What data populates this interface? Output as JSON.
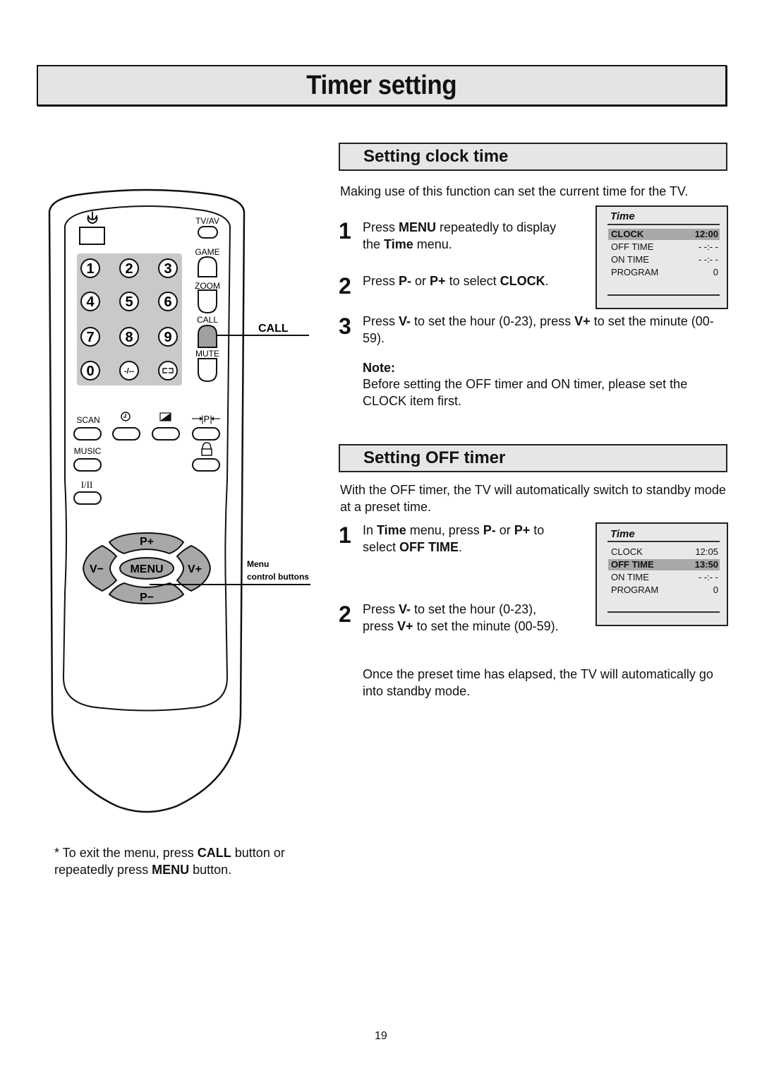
{
  "page": {
    "title": "Timer setting",
    "page_number": "19"
  },
  "remote": {
    "labels": {
      "tvav": "TV/AV",
      "game": "GAME",
      "zoom": "ZOOM",
      "call": "CALL",
      "mute": "MUTE",
      "scan": "SCAN",
      "music": "MUSIC",
      "dual": "I/II"
    },
    "digits": [
      "1",
      "2",
      "3",
      "4",
      "5",
      "6",
      "7",
      "8",
      "9",
      "0",
      "-/--"
    ],
    "nav": {
      "p_plus": "P+",
      "p_minus": "P−",
      "v_minus": "V−",
      "v_plus": "V+",
      "menu": "MENU"
    },
    "icons": [
      "power-icon",
      "clock-icon",
      "picture-mode-icon",
      "program-swap-icon",
      "lock-icon",
      "swap-icon"
    ],
    "callouts": {
      "call": "CALL",
      "menu_line1": "Menu",
      "menu_line2": "control buttons"
    },
    "colors": {
      "panel": "#c9c9c9",
      "highlight": "#a0a0a0"
    }
  },
  "footnote": {
    "prefix": "* To exit the menu, press ",
    "bold1": "CALL",
    "mid": " button or repeatedly press ",
    "bold2": "MENU",
    "suffix": " button."
  },
  "clock_section": {
    "title": "Setting clock time",
    "intro": "Making use of this function can set the current time for the TV.",
    "steps": [
      {
        "num": "1",
        "parts": [
          "Press ",
          "MENU",
          " repeatedly to display the ",
          "Time",
          " menu."
        ]
      },
      {
        "num": "2",
        "parts": [
          "Press ",
          "P-",
          " or ",
          "P+",
          " to select ",
          "CLOCK",
          "."
        ]
      },
      {
        "num": "3",
        "parts": [
          "Press ",
          "V-",
          " to set the hour (0-23), press ",
          "V+",
          " to set the minute (00-59)."
        ]
      }
    ],
    "note_label": "Note:",
    "note_text": "Before setting the OFF timer and ON timer, please set the CLOCK item first.",
    "osd": {
      "title": "Time",
      "rows": [
        {
          "label": "CLOCK",
          "value": "12:00",
          "selected": true
        },
        {
          "label": "OFF TIME",
          "value": "- -:- -",
          "selected": false
        },
        {
          "label": "ON TIME",
          "value": "- -:- -",
          "selected": false
        },
        {
          "label": "PROGRAM",
          "value": "0",
          "selected": false
        }
      ]
    }
  },
  "off_section": {
    "title": "Setting OFF timer",
    "intro": "With the OFF timer, the TV will automatically switch to standby mode at a preset time.",
    "steps": [
      {
        "num": "1",
        "parts": [
          "In ",
          "Time",
          " menu, press ",
          "P-",
          " or ",
          "P+",
          " to select ",
          "OFF TIME",
          "."
        ]
      },
      {
        "num": "2",
        "parts": [
          "Press ",
          "V-",
          " to set the hour (0-23), press ",
          "V+",
          " to set the minute (00-59)."
        ]
      }
    ],
    "closing": "Once the preset time has elapsed, the TV will automatically go into standby mode.",
    "osd": {
      "title": "Time",
      "rows": [
        {
          "label": "CLOCK",
          "value": "12:05",
          "selected": false
        },
        {
          "label": "OFF TIME",
          "value": "13:50",
          "selected": true
        },
        {
          "label": "ON TIME",
          "value": "- -:- -",
          "selected": false
        },
        {
          "label": "PROGRAM",
          "value": "0",
          "selected": false
        }
      ]
    }
  }
}
